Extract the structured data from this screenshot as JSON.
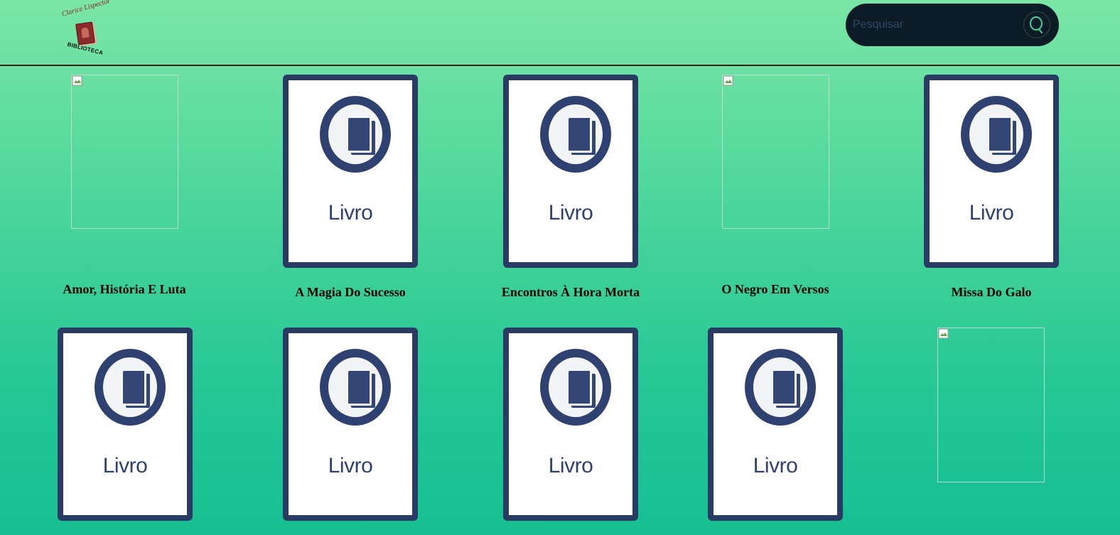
{
  "header": {
    "logo_top": "Clarice Lispector",
    "logo_bottom": "BIBLIOTECA",
    "search_placeholder": "Pesquisar"
  },
  "cover_label": "Livro",
  "books": [
    {
      "title": "Amor, História E Luta",
      "cover": "broken-image"
    },
    {
      "title": "A Magia Do Sucesso",
      "cover": "livro-placeholder"
    },
    {
      "title": "Encontros À Hora Morta",
      "cover": "livro-placeholder"
    },
    {
      "title": "O Negro Em Versos",
      "cover": "broken-image"
    },
    {
      "title": "Missa Do Galo",
      "cover": "livro-placeholder"
    },
    {
      "title": "",
      "cover": "livro-placeholder"
    },
    {
      "title": "",
      "cover": "livro-placeholder"
    },
    {
      "title": "",
      "cover": "livro-placeholder"
    },
    {
      "title": "",
      "cover": "livro-placeholder"
    },
    {
      "title": "",
      "cover": "broken-image"
    }
  ],
  "colors": {
    "cover_border": "#293b63",
    "search_bg": "#0d1b26",
    "search_icon": "#3fd39a"
  }
}
